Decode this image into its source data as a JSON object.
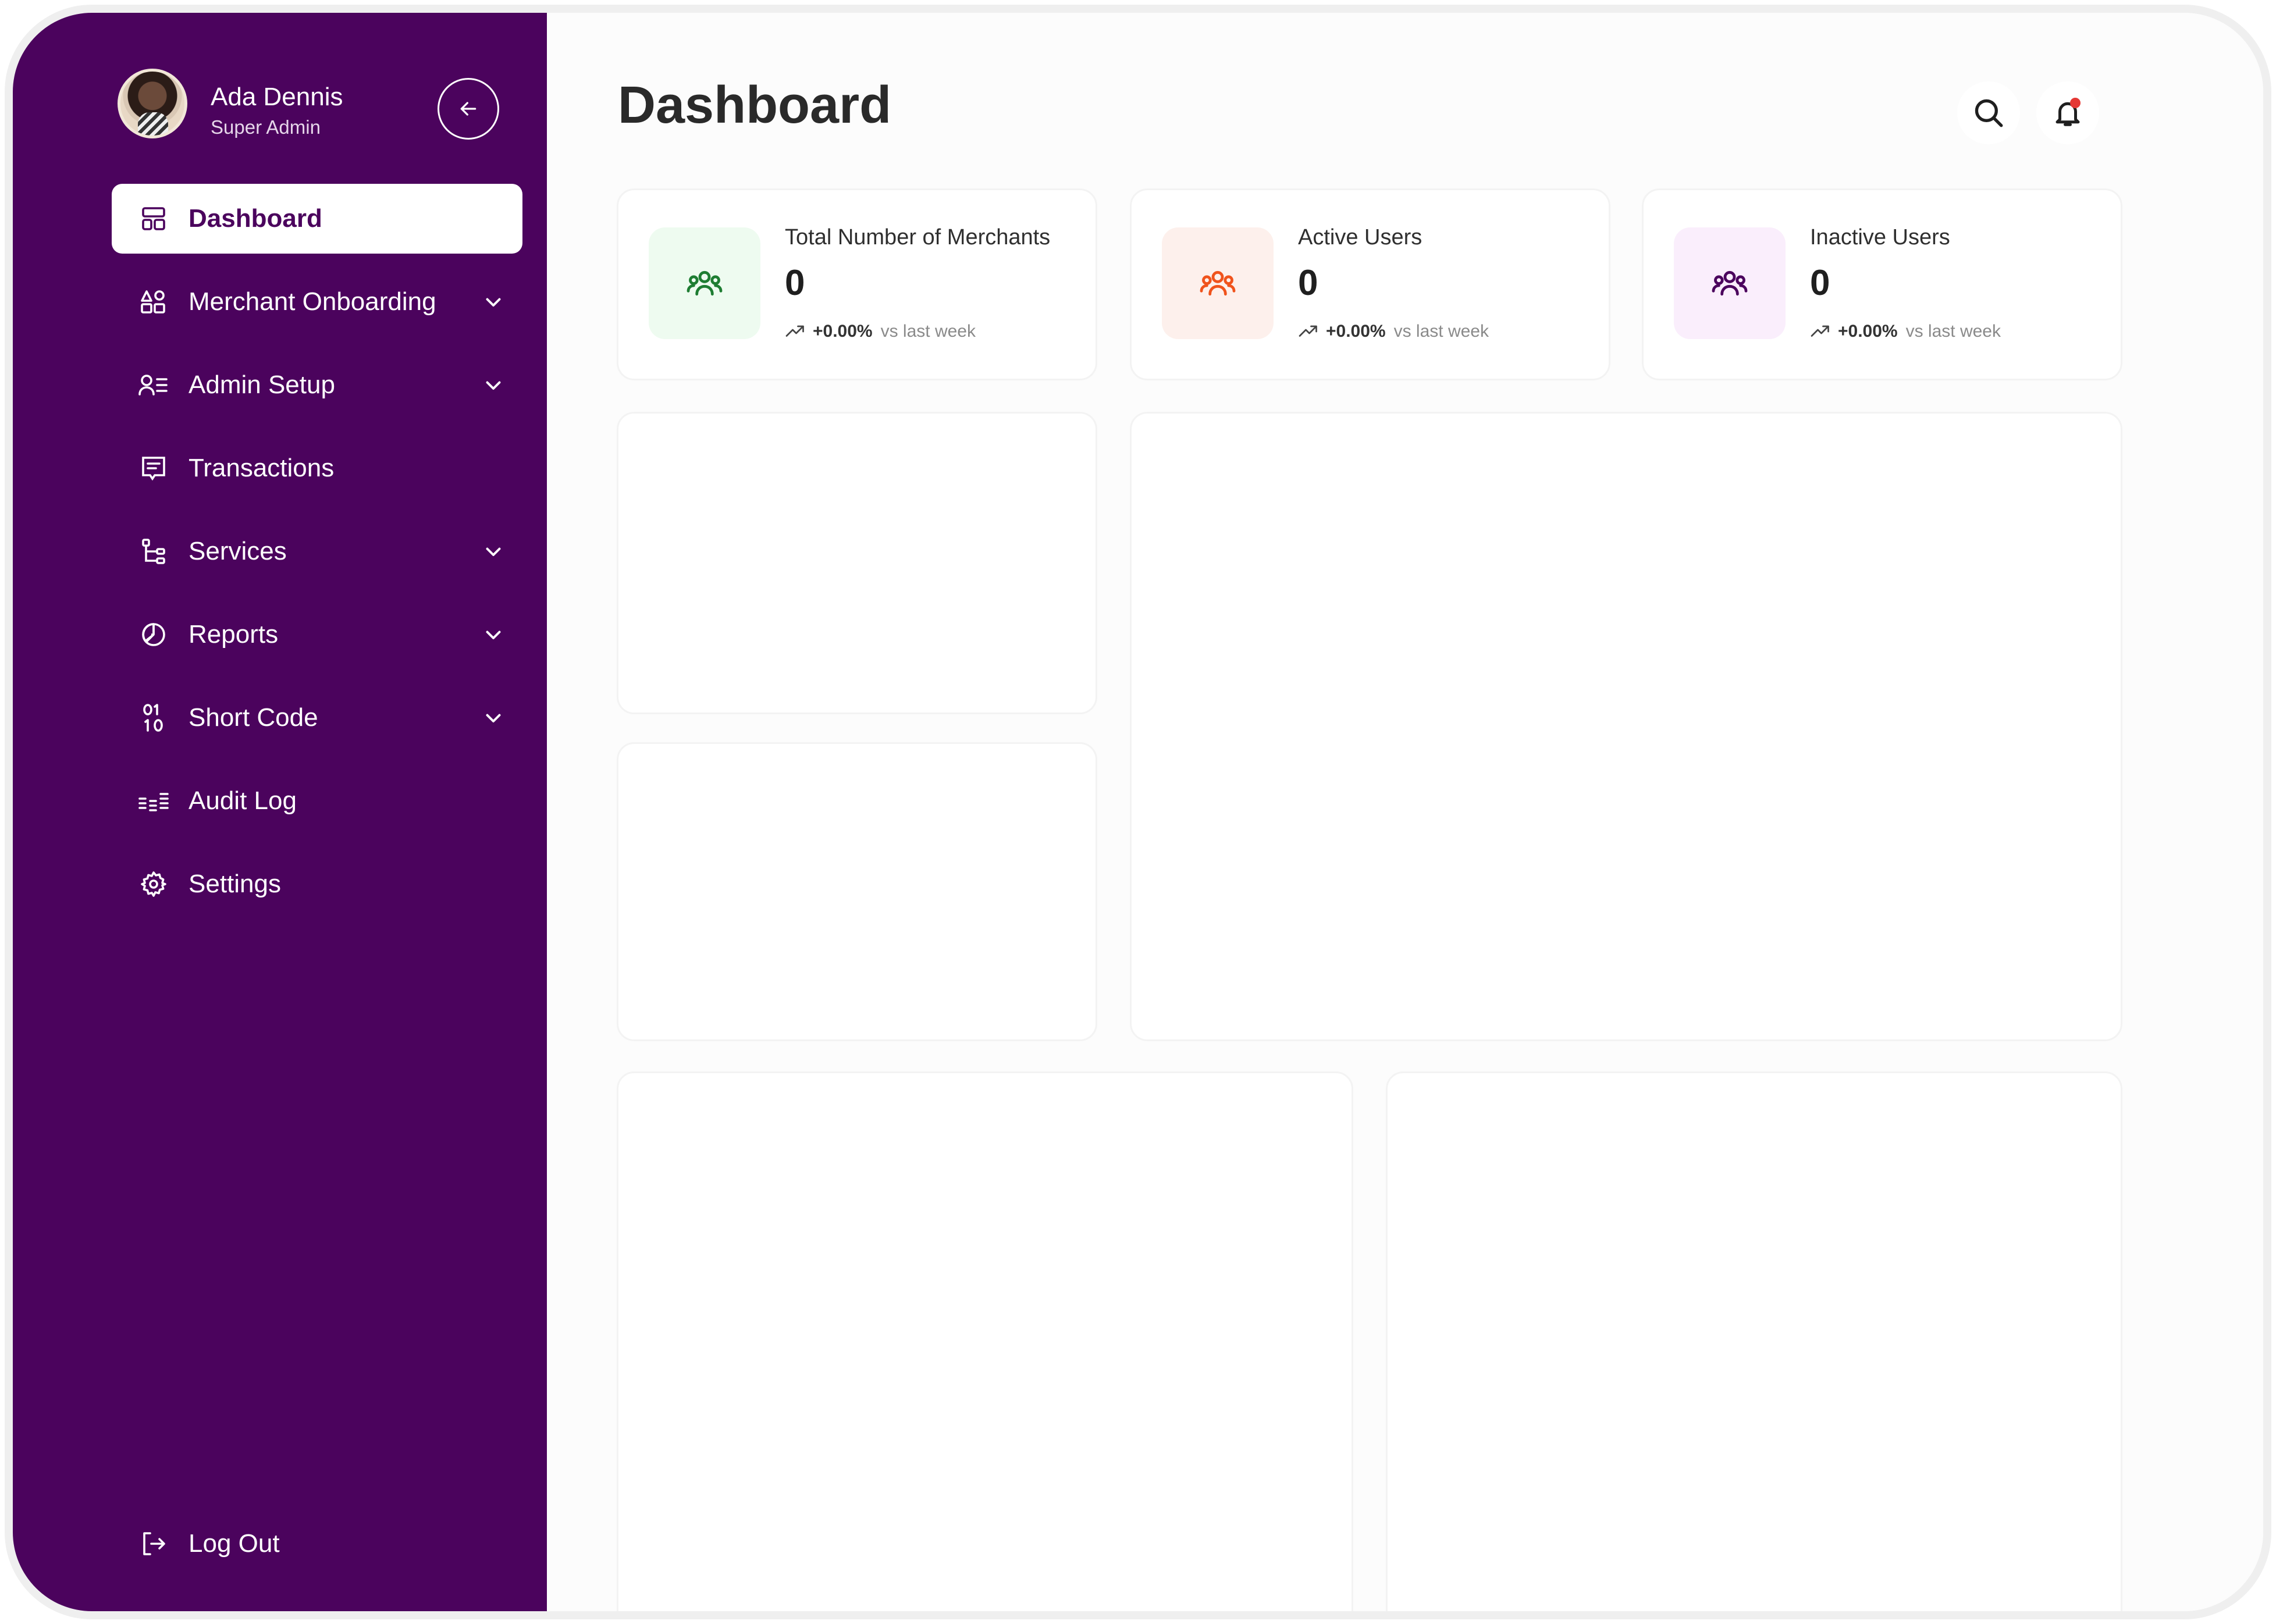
{
  "profile": {
    "name": "Ada Dennis",
    "role": "Super Admin"
  },
  "sidebar": {
    "items": [
      {
        "label": "Dashboard",
        "icon": "dashboard-icon",
        "active": true,
        "has_submenu": false
      },
      {
        "label": "Merchant Onboarding",
        "icon": "shapes-icon",
        "active": false,
        "has_submenu": true
      },
      {
        "label": "Admin Setup",
        "icon": "user-list-icon",
        "active": false,
        "has_submenu": true
      },
      {
        "label": "Transactions",
        "icon": "receipt-icon",
        "active": false,
        "has_submenu": false
      },
      {
        "label": "Services",
        "icon": "hierarchy-icon",
        "active": false,
        "has_submenu": true
      },
      {
        "label": "Reports",
        "icon": "pie-chart-icon",
        "active": false,
        "has_submenu": true
      },
      {
        "label": "Short Code",
        "icon": "binary-icon",
        "active": false,
        "has_submenu": true
      },
      {
        "label": "Audit Log",
        "icon": "audit-icon",
        "active": false,
        "has_submenu": false
      },
      {
        "label": "Settings",
        "icon": "gear-icon",
        "active": false,
        "has_submenu": false
      }
    ],
    "logout_label": "Log Out"
  },
  "header": {
    "title": "Dashboard"
  },
  "stats": [
    {
      "label": "Total Number of Merchants",
      "value": "0",
      "change": "+0.00%",
      "comparison": "vs last week",
      "icon": "users-icon",
      "icon_color": "#1e7d32",
      "icon_bg": "#eefbf0"
    },
    {
      "label": "Active Users",
      "value": "0",
      "change": "+0.00%",
      "comparison": "vs last week",
      "icon": "users-icon",
      "icon_color": "#f0531c",
      "icon_bg": "#fdf0ec"
    },
    {
      "label": "Inactive Users",
      "value": "0",
      "change": "+0.00%",
      "comparison": "vs last week",
      "icon": "users-icon",
      "icon_color": "#4b035d",
      "icon_bg": "#faeefc"
    }
  ],
  "colors": {
    "sidebar_bg": "#4b035d",
    "page_bg": "#fcfcfc",
    "notification_dot": "#e53935"
  }
}
